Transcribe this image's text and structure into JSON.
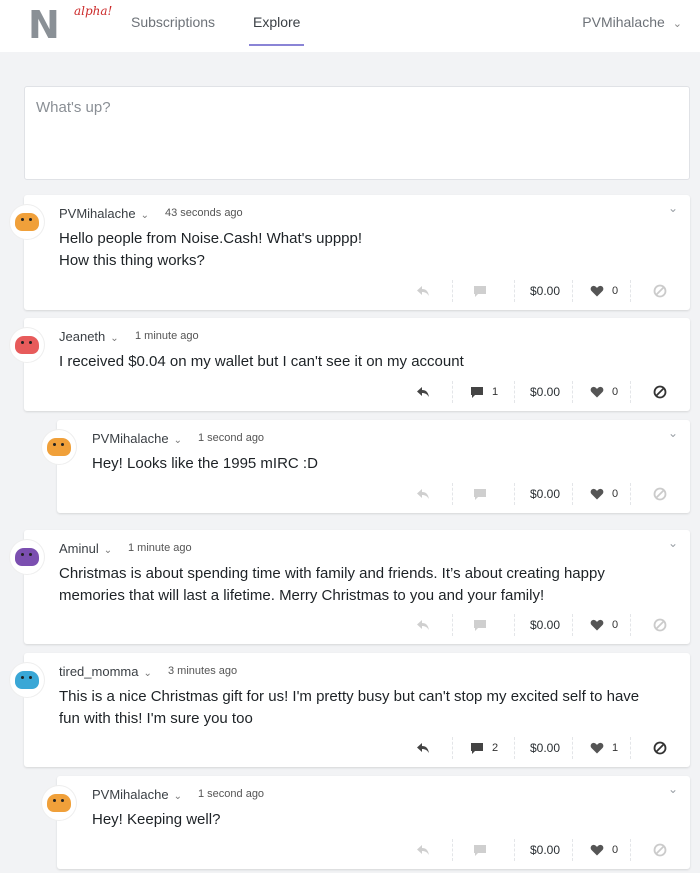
{
  "nav": {
    "logo_letter": "N",
    "logo_tag": "alpha!",
    "subscriptions": "Subscriptions",
    "explore": "Explore",
    "user": "PVMihalache"
  },
  "composer": {
    "placeholder": "What's up?"
  },
  "posts": [
    {
      "author": "PVMihalache",
      "time": "43 seconds ago",
      "lines": [
        "Hello people from Noise.Cash! What's upppp!",
        "How this thing works?"
      ],
      "comments": "",
      "tips": "$0.00",
      "likes": "0",
      "avatar_color": "#f0a03a"
    },
    {
      "author": "Jeaneth",
      "time": "1 minute ago",
      "lines": [
        "I received $0.04 on my wallet but I can't see it on my account"
      ],
      "comments": "1",
      "tips": "$0.00",
      "likes": "0",
      "avatar_color": "#e75b5b"
    },
    {
      "author": "PVMihalache",
      "time": "1 second ago",
      "lines": [
        "Hey! Looks like the 1995 mIRC :D"
      ],
      "comments": "",
      "tips": "$0.00",
      "likes": "0",
      "avatar_color": "#f0a03a"
    },
    {
      "author": "Aminul",
      "time": "1 minute ago",
      "lines": [
        "Christmas is about spending time with family and friends. It’s about creating happy",
        "memories that will last a lifetime. Merry Christmas to you and your family!"
      ],
      "comments": "",
      "tips": "$0.00",
      "likes": "0",
      "avatar_color": "#7b4fb0"
    },
    {
      "author": "tired_momma",
      "time": "3 minutes ago",
      "lines": [
        "This is a nice Christmas gift for us! I'm pretty busy but can't stop my excited self to have",
        "fun with this! I'm sure you too"
      ],
      "comments": "2",
      "tips": "$0.00",
      "likes": "1",
      "avatar_color": "#3aa7d6"
    },
    {
      "author": "PVMihalache",
      "time": "1 second ago",
      "lines": [
        "Hey! Keeping well?"
      ],
      "comments": "",
      "tips": "$0.00",
      "likes": "0",
      "avatar_color": "#f0a03a"
    }
  ]
}
